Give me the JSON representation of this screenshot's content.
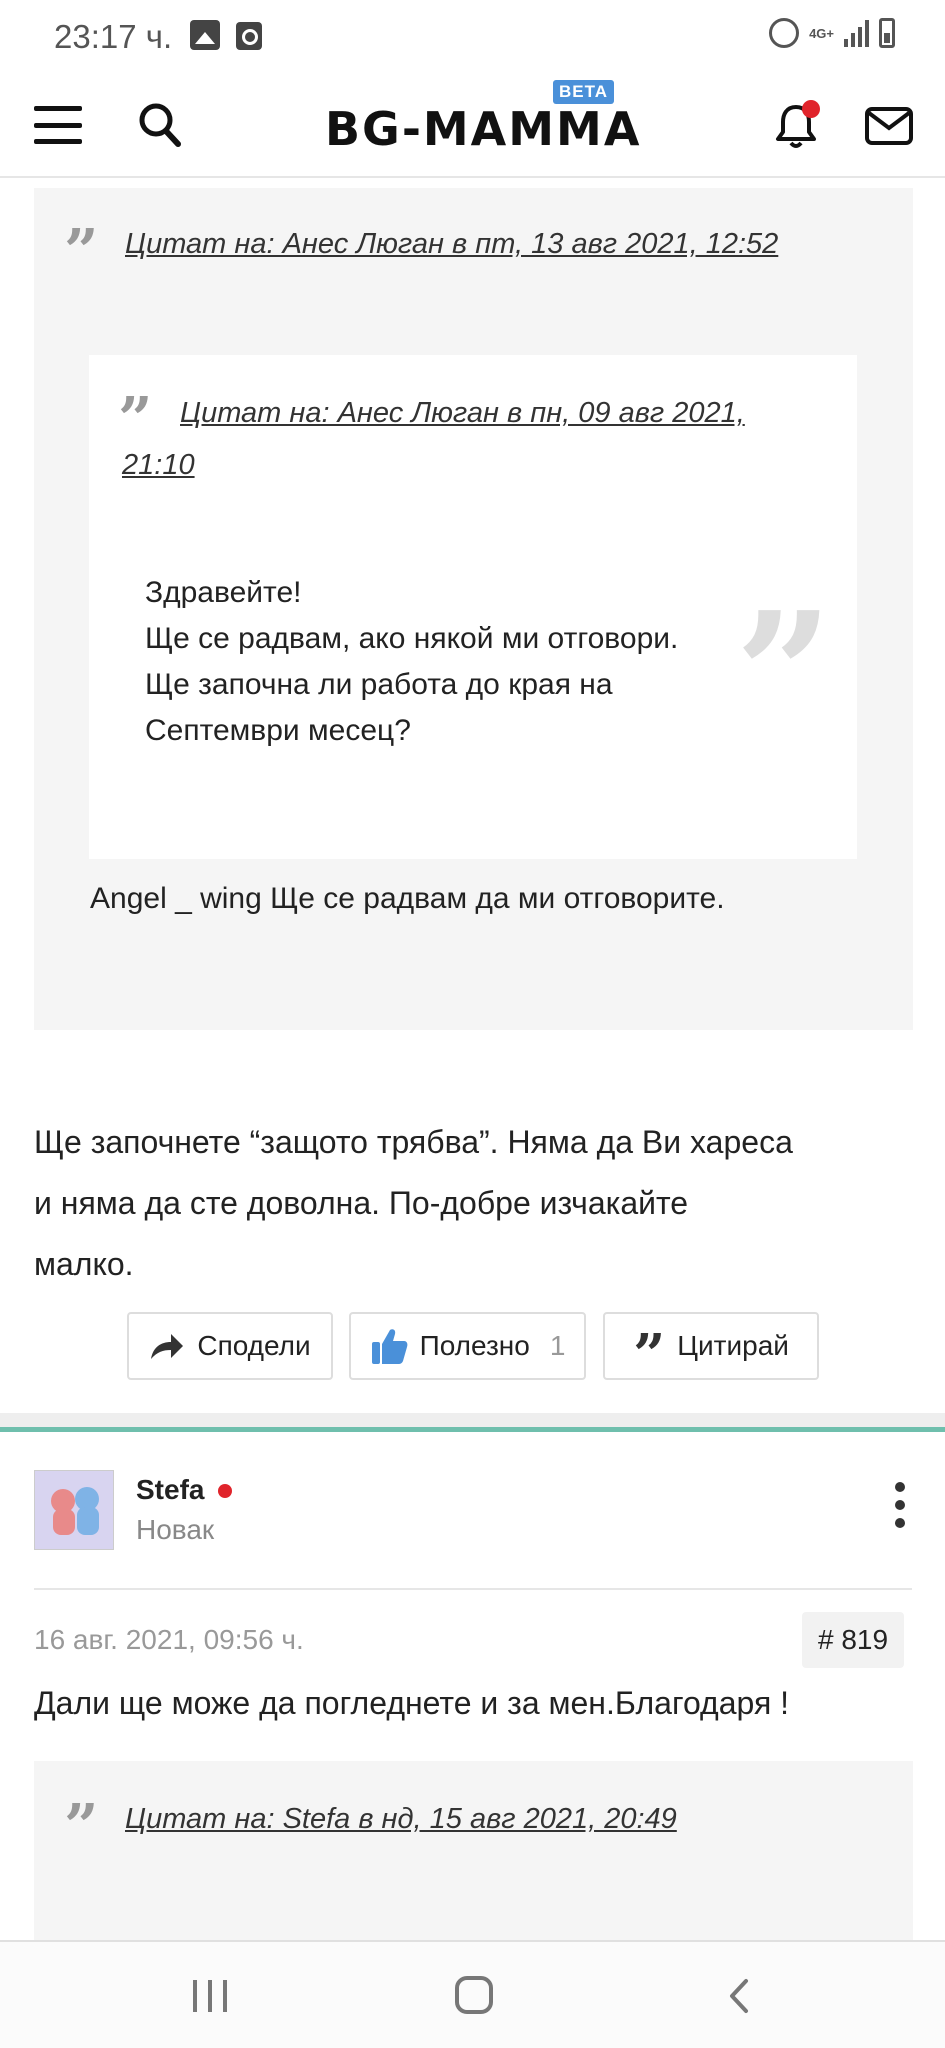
{
  "status_bar": {
    "time": "23:17 ч.",
    "network": "4G+"
  },
  "header": {
    "logo": "BG-MAMMA",
    "badge": "BETA"
  },
  "quote_outer": {
    "header": "Цитат на: Анес Люган в пт, 13 авг 2021, 12:52",
    "reply": "Angel _ wing Ще се радвам да ми отговорите."
  },
  "quote_inner": {
    "header_line1": "Цитат на: Анес Люган в пн, 09 авг 2021,",
    "header_line2": "21:10",
    "body": [
      "Здравейте!",
      "Ще се радвам, ако някой ми отговори.",
      "Ще започна ли работа до края на",
      "Септември месец?"
    ]
  },
  "post": {
    "text": [
      "Ще започнете “защото трябва”. Няма да Ви хареса",
      "и няма да сте доволна. По-добре изчакайте",
      "малко."
    ]
  },
  "actions": {
    "share": "Сподели",
    "useful": "Полезно",
    "useful_count": "1",
    "quote": "Цитирай"
  },
  "user": {
    "name": "Stefa",
    "rank": "Новак"
  },
  "post2": {
    "date": "16 авг. 2021, 09:56 ч.",
    "number": "# 819",
    "text": "Дали ще може да погледнете и за мен.Благодаря !"
  },
  "quote2": {
    "header": "Цитат на: Stefa в нд, 15 авг 2021, 20:49"
  },
  "colors": {
    "accent_teal": "#6fbfad",
    "like_blue": "#4a90d9",
    "notification_red": "#e0242b"
  }
}
